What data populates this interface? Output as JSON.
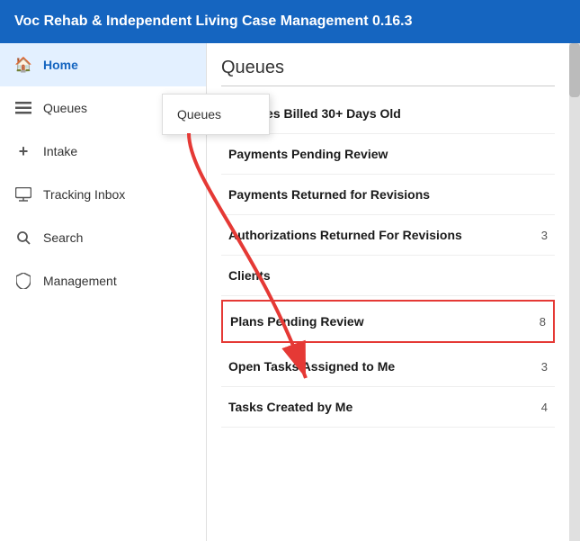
{
  "header": {
    "title": "Voc Rehab & Independent Living Case Management 0.16.3"
  },
  "sidebar": {
    "items": [
      {
        "id": "home",
        "label": "Home",
        "icon": "🏠",
        "active": true
      },
      {
        "id": "queues",
        "label": "Queues",
        "icon": "☰",
        "active": false
      },
      {
        "id": "intake",
        "label": "Intake",
        "icon": "+",
        "active": false
      },
      {
        "id": "tracking-inbox",
        "label": "Tracking Inbox",
        "icon": "☐",
        "active": false
      },
      {
        "id": "search",
        "label": "Search",
        "icon": "🔍",
        "active": false
      },
      {
        "id": "management",
        "label": "Management",
        "icon": "🛡",
        "active": false
      }
    ],
    "tooltip": {
      "label": "Queues"
    }
  },
  "content": {
    "title": "Queues",
    "queue_items": [
      {
        "id": "services-billed",
        "label": "Services Billed 30+ Days Old",
        "count": ""
      },
      {
        "id": "payments-pending",
        "label": "Payments Pending Review",
        "count": ""
      },
      {
        "id": "payments-returned",
        "label": "Payments Returned for Revisions",
        "count": ""
      },
      {
        "id": "authorizations-returned",
        "label": "Authorizations Returned For Revisions",
        "count": "3"
      },
      {
        "id": "clients",
        "label": "Clients",
        "count": ""
      },
      {
        "id": "plans-pending",
        "label": "Plans Pending Review",
        "count": "8",
        "highlighted": true
      },
      {
        "id": "open-tasks",
        "label": "Open Tasks Assigned to Me",
        "count": "3"
      },
      {
        "id": "tasks-created",
        "label": "Tasks Created by Me",
        "count": "4"
      }
    ]
  }
}
